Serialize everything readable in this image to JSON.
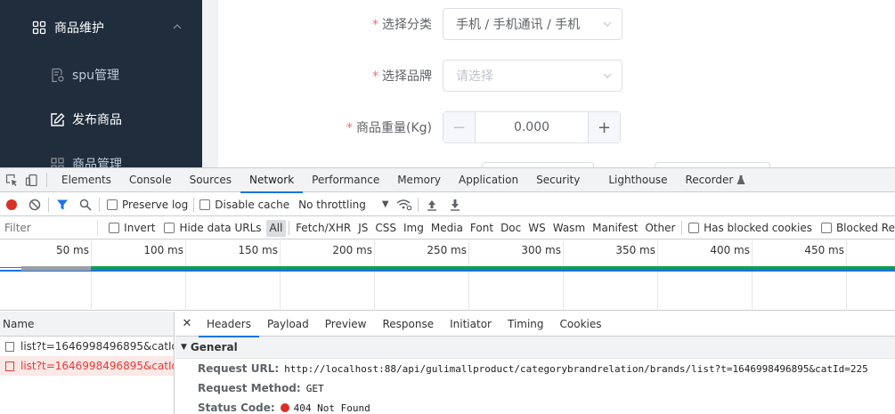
{
  "sidebar": {
    "group_label": "商品维护",
    "items": [
      {
        "label": "spu管理"
      },
      {
        "label": "发布商品"
      },
      {
        "label": "商品管理"
      }
    ]
  },
  "form": {
    "category": {
      "label": "选择分类",
      "value": "手机 / 手机通讯 / 手机"
    },
    "brand": {
      "label": "选择品牌",
      "placeholder": "请选择"
    },
    "weight": {
      "label": "商品重量(Kg)",
      "value": "0.000"
    }
  },
  "devtools": {
    "tabs": [
      "Elements",
      "Console",
      "Sources",
      "Network",
      "Performance",
      "Memory",
      "Application",
      "Security",
      "Lighthouse",
      "Recorder"
    ],
    "active_tab": "Network",
    "toolbar": {
      "preserve_log": "Preserve log",
      "disable_cache": "Disable cache",
      "throttling": "No throttling"
    },
    "filter": {
      "placeholder": "Filter",
      "invert": "Invert",
      "hide_data_urls": "Hide data URLs",
      "types": [
        "All",
        "Fetch/XHR",
        "JS",
        "CSS",
        "Img",
        "Media",
        "Font",
        "Doc",
        "WS",
        "Wasm",
        "Manifest",
        "Other"
      ],
      "has_blocked_cookies": "Has blocked cookies",
      "blocked_requests": "Blocked Re"
    },
    "timeline": {
      "ticks": [
        "50 ms",
        "100 ms",
        "150 ms",
        "200 ms",
        "250 ms",
        "300 ms",
        "350 ms",
        "400 ms",
        "450 ms"
      ]
    },
    "requests": {
      "header": "Name",
      "rows": [
        {
          "name": "list?t=1646998496895&catId...",
          "error": false
        },
        {
          "name": "list?t=1646998496895&catId...",
          "error": true
        }
      ]
    },
    "detail": {
      "tabs": [
        "Headers",
        "Payload",
        "Preview",
        "Response",
        "Initiator",
        "Timing",
        "Cookies"
      ],
      "active_tab": "Headers",
      "section": "General",
      "request_url_label": "Request URL:",
      "request_url": "http://localhost:88/api/gulimallproduct/categorybrandrelation/brands/list?t=1646998496895&catId=225",
      "request_method_label": "Request Method:",
      "request_method": "GET",
      "status_code_label": "Status Code:",
      "status_code": "404 Not Found"
    }
  },
  "colors": {
    "sidebar_bg": "#1f2d3d",
    "accent": "#1a73e8",
    "error": "#d93025",
    "required": "#f56c6c"
  }
}
